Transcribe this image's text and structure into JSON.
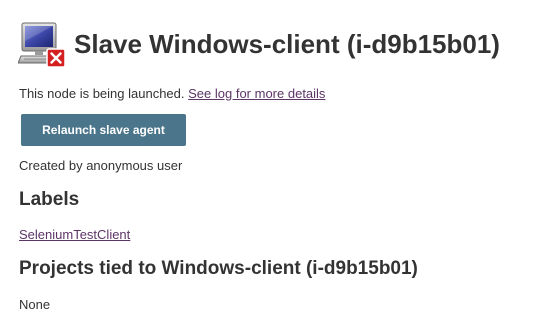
{
  "header": {
    "title": "Slave Windows-client (i-d9b15b01)",
    "icon": "computer-offline-icon"
  },
  "status": {
    "message": "This node is being launched.",
    "log_link": "See log for more details"
  },
  "actions": {
    "relaunch_label": "Relaunch slave agent"
  },
  "created_by": "Created by anonymous user",
  "labels": {
    "heading": "Labels",
    "items": [
      "SeleniumTestClient"
    ]
  },
  "projects": {
    "heading": "Projects tied to Windows-client (i-d9b15b01)",
    "empty_text": "None"
  },
  "colors": {
    "button_bg": "#4b758b",
    "link": "#5c3566",
    "text": "#333333",
    "error_badge": "#d42020"
  }
}
